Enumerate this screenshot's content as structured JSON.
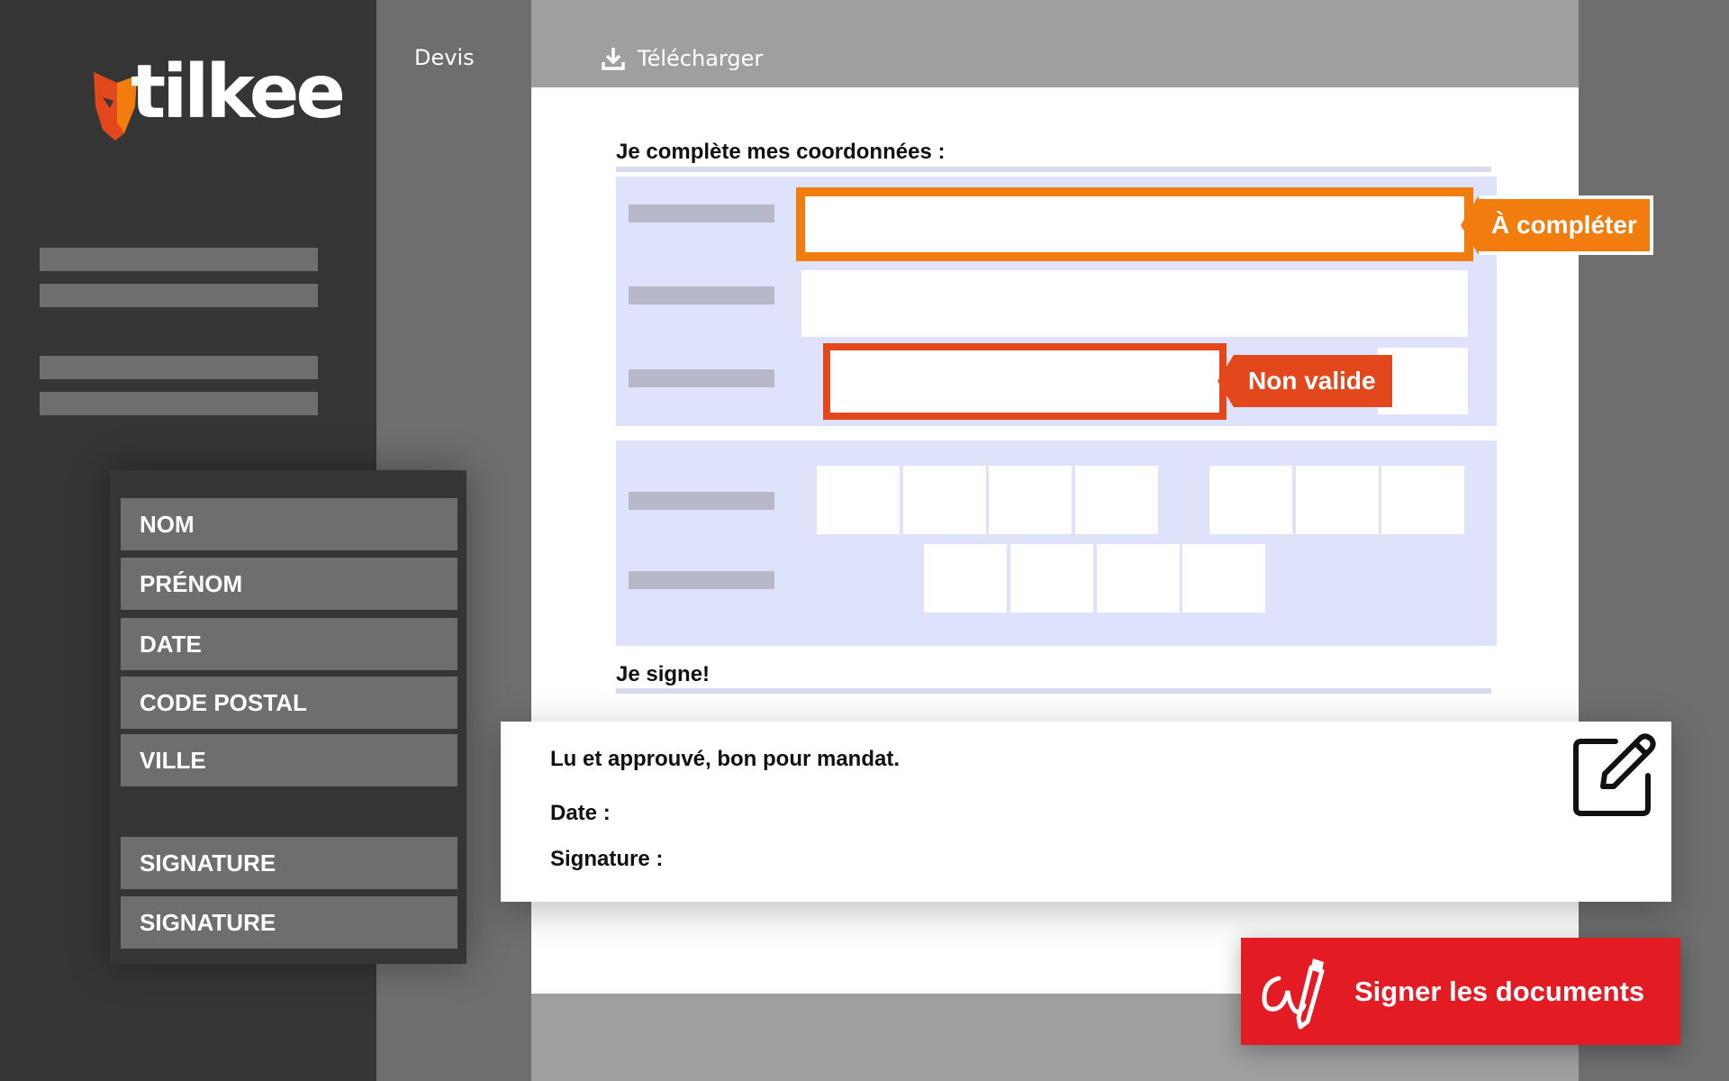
{
  "brand": {
    "name": "tilkee",
    "accent_orange": "#f07d0d",
    "accent_red": "#e31b23"
  },
  "tabs": {
    "devis": "Devis",
    "telecharger": "Télécharger"
  },
  "form": {
    "section_coords": "Je complète mes coordonnées :",
    "tag_completer": "À compléter",
    "tag_nonvalide": "Non valide",
    "section_sign": "Je signe!"
  },
  "fields_panel": {
    "items": [
      "NOM",
      "PRÉNOM",
      "DATE",
      "CODE POSTAL",
      "VILLE",
      "SIGNATURE",
      "SIGNATURE"
    ]
  },
  "sign_card": {
    "approval": "Lu et approuvé, bon pour mandat.",
    "date_label": "Date :",
    "signature_label": "Signature :"
  },
  "sign_button": {
    "label": "Signer les documents",
    "icon": "signature-pen-icon"
  }
}
